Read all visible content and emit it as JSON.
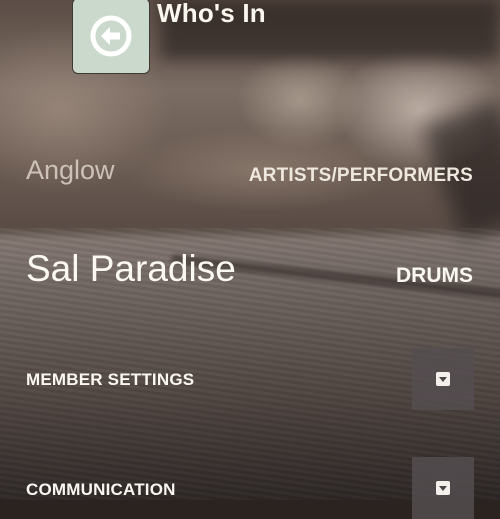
{
  "header": {
    "title": "Who's In",
    "back_icon": "arrow-left-circle-icon",
    "back_button_color": "#cbd9cc"
  },
  "group": {
    "name": "Anglow",
    "category": "ARTISTS/PERFORMERS"
  },
  "member": {
    "name": "Sal Paradise",
    "role": "DRUMS"
  },
  "sections": {
    "member_settings": {
      "label": "MEMBER SETTINGS",
      "toggle_icon": "chevron-down-icon"
    },
    "communication": {
      "label": "COMMUNICATION",
      "toggle_icon": "chevron-down-icon"
    }
  }
}
